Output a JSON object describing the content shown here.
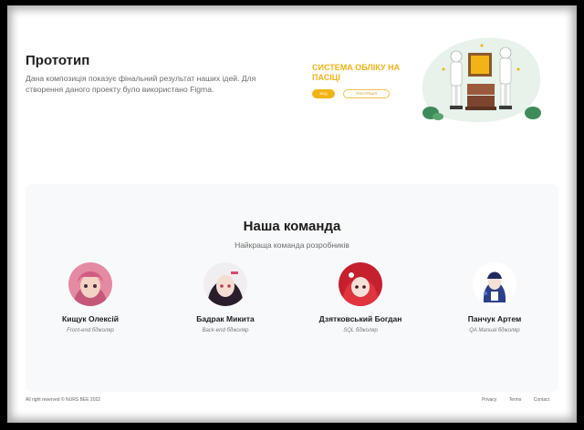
{
  "prototype": {
    "title": "Прототип",
    "description": "Дана композиція показує фінальний результат наших ідей. Для створення даного проекту було використано Figma."
  },
  "mockup": {
    "title": "СИСТЕМА ОБЛІКУ НА ПАСІЦІ",
    "button_primary": "ВХІД",
    "button_secondary": "РЕЄСТРАЦІЯ"
  },
  "team": {
    "title": "Наша команда",
    "subtitle": "Найкраща команда розробників",
    "members": [
      {
        "name": "Кищук Олексій",
        "role": "Front-end бджоляр"
      },
      {
        "name": "Бадрак Микита",
        "role": "Back-end бджоляр"
      },
      {
        "name": "Дзятковський Богдан",
        "role": "SQL бджоляр"
      },
      {
        "name": "Панчук Артем",
        "role": "QA Manual бджоляр"
      }
    ]
  },
  "footer": {
    "copyright": "All right reserved © NURS BEE 2022",
    "links": [
      "Privacy",
      "Terms",
      "Contact"
    ]
  },
  "colors": {
    "accent": "#f2b316",
    "team_bg": "#f8f9fa"
  }
}
